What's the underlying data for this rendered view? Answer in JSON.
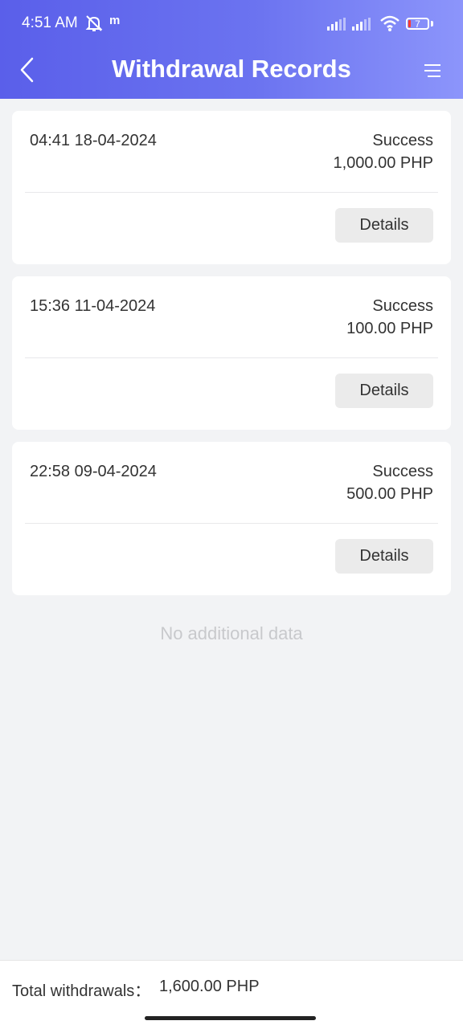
{
  "status_bar": {
    "time": "4:51 AM",
    "carrier_icon": "m",
    "battery_level": "7",
    "icons": [
      "bell-muted-icon",
      "signal-icon",
      "signal-icon",
      "wifi-icon",
      "battery-icon"
    ]
  },
  "header": {
    "title": "Withdrawal Records",
    "back_icon": "chevron-left-icon",
    "menu_icon": "menu-icon"
  },
  "records": [
    {
      "time": "04:41 18-04-2024",
      "status": "Success",
      "amount": "1,000.00 PHP",
      "details_label": "Details"
    },
    {
      "time": "15:36 11-04-2024",
      "status": "Success",
      "amount": "100.00 PHP",
      "details_label": "Details"
    },
    {
      "time": "22:58 09-04-2024",
      "status": "Success",
      "amount": "500.00 PHP",
      "details_label": "Details"
    }
  ],
  "empty_text": "No additional data",
  "footer": {
    "total_label": "Total withdrawals：",
    "total_value": "1,600.00 PHP"
  },
  "colors": {
    "header_gradient_start": "#5a5fea",
    "header_gradient_end": "#8c95fb",
    "background": "#f2f3f5",
    "button_bg": "#ebebeb"
  }
}
